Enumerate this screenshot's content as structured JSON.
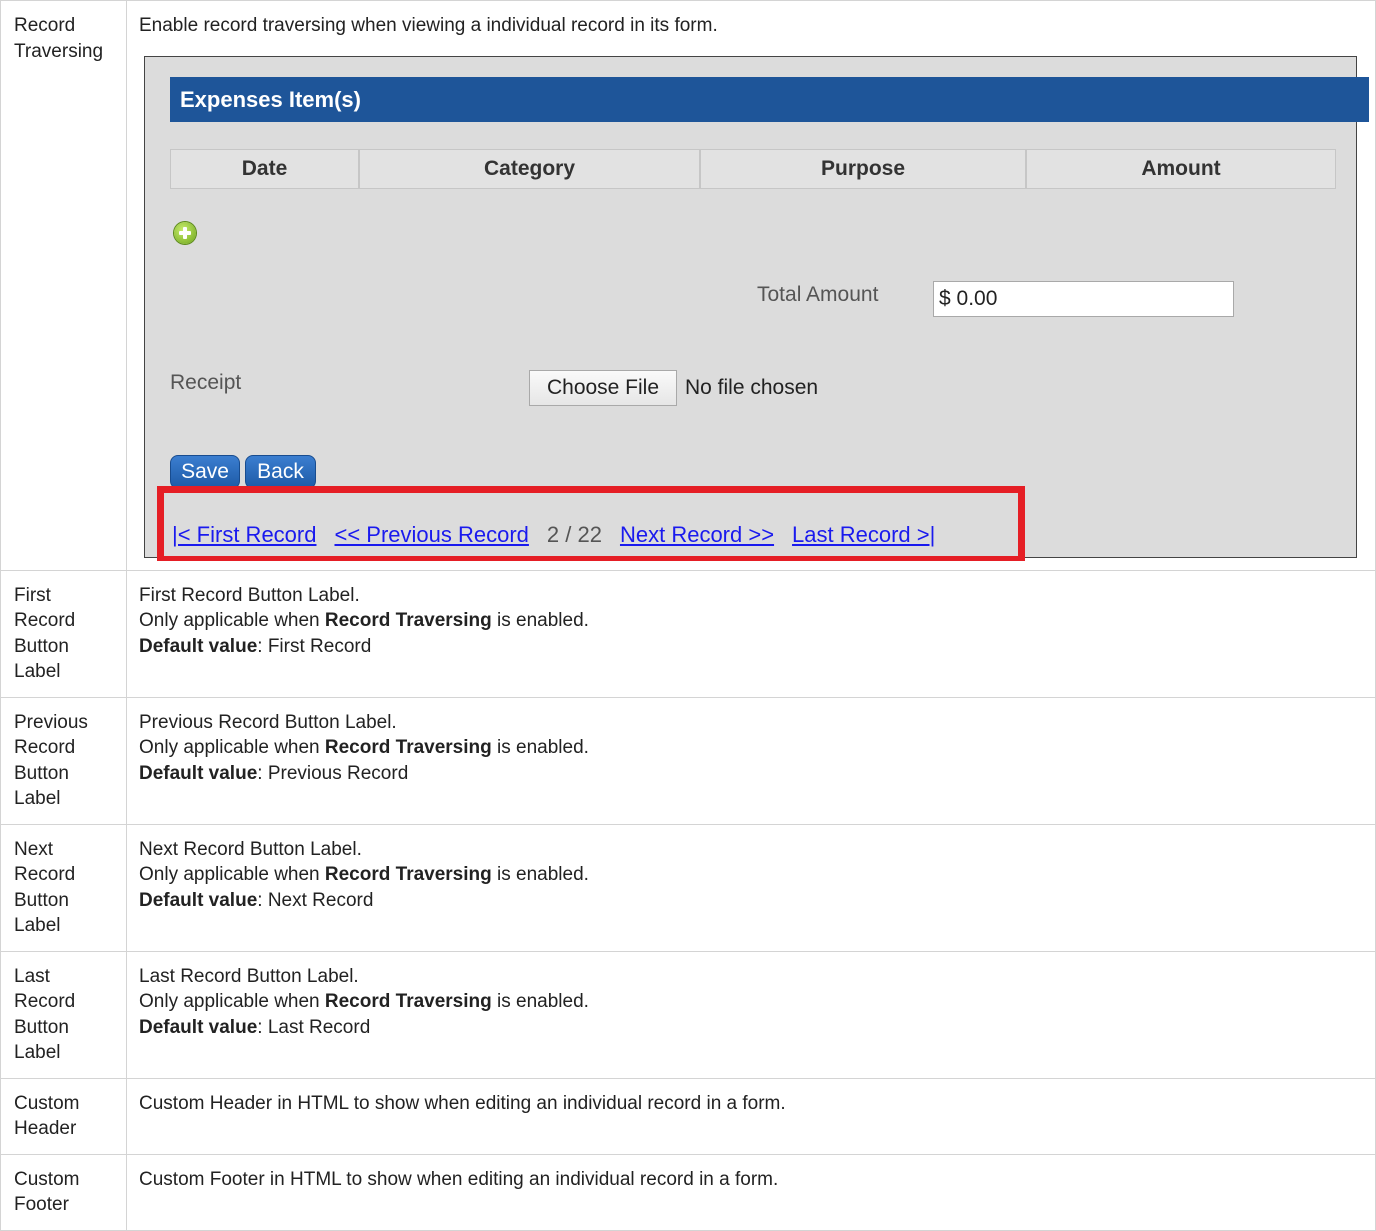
{
  "rows": {
    "record_traversing": {
      "name": "Record Traversing",
      "desc": "Enable record traversing when viewing a individual record in its form."
    },
    "first": {
      "name": "First Record Button Label",
      "desc": "First Record Button Label.",
      "applies_prefix": "Only applicable when ",
      "applies_bold": "Record Traversing",
      "applies_suffix": " is enabled.",
      "default_label": "Default value",
      "default_value": ": First Record"
    },
    "previous": {
      "name": "Previous Record Button Label",
      "desc": "Previous Record Button Label.",
      "applies_prefix": "Only applicable when ",
      "applies_bold": "Record Traversing",
      "applies_suffix": " is enabled.",
      "default_label": "Default value",
      "default_value": ": Previous Record"
    },
    "next": {
      "name": "Next Record Button Label",
      "desc": "Next Record Button Label.",
      "applies_prefix": "Only applicable when ",
      "applies_bold": "Record Traversing",
      "applies_suffix": " is enabled.",
      "default_label": "Default value",
      "default_value": ": Next Record"
    },
    "last": {
      "name": "Last Record Button Label",
      "desc": "Last Record Button Label.",
      "applies_prefix": "Only applicable when ",
      "applies_bold": "Record Traversing",
      "applies_suffix": " is enabled.",
      "default_label": "Default value",
      "default_value": ": Last Record"
    },
    "custom_header": {
      "name": "Custom Header",
      "desc": "Custom Header in HTML to show when editing an individual record in a form."
    },
    "custom_footer": {
      "name": "Custom Footer",
      "desc": "Custom Footer in HTML to show when editing an individual record in a form."
    }
  },
  "form": {
    "section_title": "Expenses Item(s)",
    "columns": [
      "Date",
      "Category",
      "Purpose",
      "Amount"
    ],
    "total_label": "Total Amount",
    "total_value": "$ 0.00",
    "receipt_label": "Receipt",
    "choose_file_label": "Choose File",
    "no_file_text": "No file chosen",
    "save_label": "Save",
    "back_label": "Back",
    "nav": {
      "first": "|< First Record",
      "previous": "<< Previous Record",
      "count": "2 / 22",
      "next": "Next Record >>",
      "last": "Last Record >|"
    },
    "highlight_color": "#e51e25",
    "header_color": "#1e5599"
  }
}
